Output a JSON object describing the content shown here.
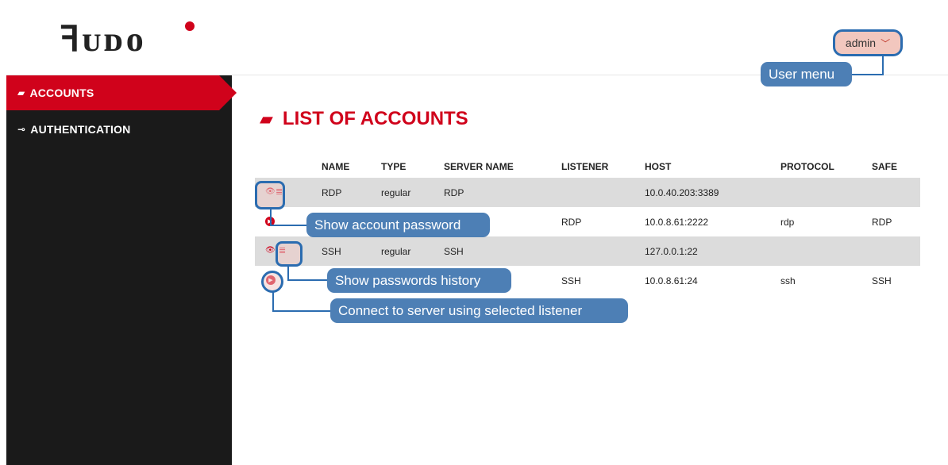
{
  "app": {
    "logo_text": "ꟻᴜᴅᴏ"
  },
  "header": {
    "user_label": "admin",
    "user_chevron": "﹀"
  },
  "sidebar": {
    "items": [
      {
        "label": "ACCOUNTS",
        "icon": "book-icon",
        "glyph": "▰",
        "active": true
      },
      {
        "label": "AUTHENTICATION",
        "icon": "key-icon",
        "glyph": "⊸",
        "active": false
      }
    ]
  },
  "main": {
    "title": "LIST OF ACCOUNTS",
    "title_icon": "▰",
    "columns": [
      "NAME",
      "TYPE",
      "SERVER NAME",
      "LISTENER",
      "HOST",
      "PROTOCOL",
      "SAFE"
    ],
    "rows": [
      {
        "name": "RDP",
        "type": "regular",
        "server": "RDP",
        "listener": "",
        "host": "10.0.40.203:3389",
        "protocol": "",
        "safe": ""
      },
      {
        "name": "",
        "type": "",
        "server": "",
        "listener": "RDP",
        "host": "10.0.8.61:2222",
        "protocol": "rdp",
        "safe": "RDP"
      },
      {
        "name": "SSH",
        "type": "regular",
        "server": "SSH",
        "listener": "",
        "host": "127.0.0.1:22",
        "protocol": "",
        "safe": ""
      },
      {
        "name": "",
        "type": "",
        "server": "",
        "listener": "SSH",
        "host": "10.0.8.61:24",
        "protocol": "ssh",
        "safe": "SSH"
      }
    ]
  },
  "icons": {
    "eye": "👁",
    "list": "≣",
    "play": "▶"
  },
  "callouts": {
    "user_menu": "User menu",
    "show_password": "Show account password",
    "passwords_history": "Show passwords history",
    "connect": "Connect to server using selected listener"
  },
  "colors": {
    "brand_red": "#d0021b",
    "sidebar_bg": "#1a1a1a",
    "callout_bg": "#4d7fb5",
    "highlight": "#2b6cb0"
  }
}
